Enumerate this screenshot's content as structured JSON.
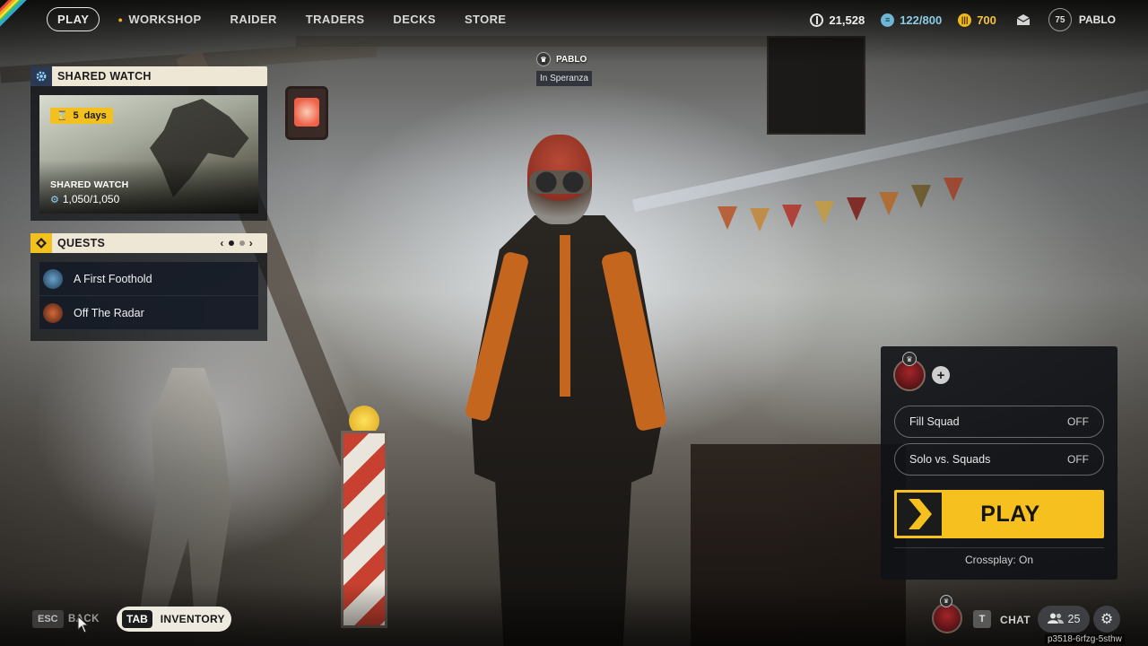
{
  "nav": {
    "play": "PLAY",
    "items": [
      "WORKSHOP",
      "RAIDER",
      "TRADERS",
      "DECKS",
      "STORE"
    ]
  },
  "currency": {
    "coins": "21,528",
    "tokens": "122/800",
    "creds": "700"
  },
  "player": {
    "level": "75",
    "name": "PABLO",
    "location": "In Speranza"
  },
  "shared_watch": {
    "header": "SHARED WATCH",
    "days_badge": "5  days",
    "title": "SHARED WATCH",
    "progress": "1,050/1,050"
  },
  "quests": {
    "header": "QUESTS",
    "page_index": 0,
    "page_count": 2,
    "items": [
      {
        "label": "A First Foothold"
      },
      {
        "label": "Off The Radar"
      }
    ]
  },
  "play_panel": {
    "fill_squad": {
      "label": "Fill Squad",
      "value": "OFF"
    },
    "solo_vs_squads": {
      "label": "Solo vs. Squads",
      "value": "OFF"
    },
    "play_button": "PLAY",
    "crossplay": "Crossplay: On"
  },
  "bottom": {
    "esc_key": "ESC",
    "back": "BACK",
    "tab_key": "TAB",
    "inventory": "INVENTORY",
    "chat_key": "T",
    "chat": "CHAT",
    "friends_count": "25",
    "build_id": "p3518-6rfzg-5sthw"
  },
  "colors": {
    "accent_yellow": "#f6c11e",
    "panel_header": "#efe7d6",
    "panel_bg": "#101216"
  },
  "icons": {
    "coins": "ring-coin-icon",
    "tokens": "token-icon",
    "creds": "cred-icon",
    "inbox": "mail-icon",
    "settings": "gear-icon",
    "friends": "people-icon"
  }
}
